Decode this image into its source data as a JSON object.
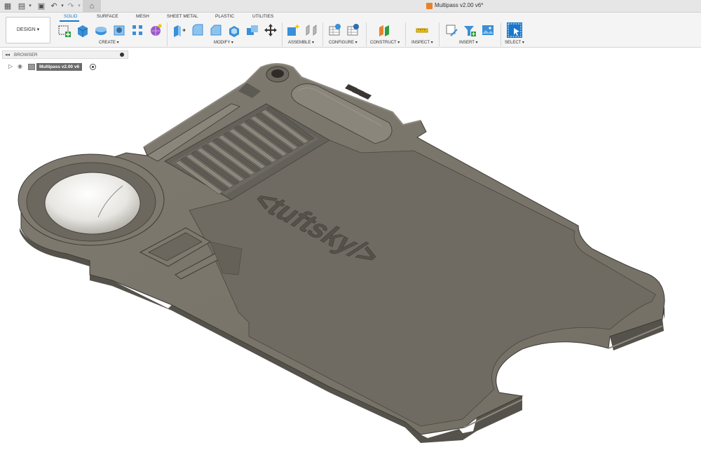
{
  "titlebar": {
    "document_title": "Multipass v2.00 v6*"
  },
  "ribbon": {
    "workspace_label": "DESIGN ▾",
    "tabs": [
      {
        "label": "SOLID",
        "active": true
      },
      {
        "label": "SURFACE"
      },
      {
        "label": "MESH"
      },
      {
        "label": "SHEET METAL"
      },
      {
        "label": "PLASTIC"
      },
      {
        "label": "UTILITIES"
      }
    ],
    "groups": {
      "create": "CREATE ▾",
      "modify": "MODIFY ▾",
      "assemble": "ASSEMBLE ▾",
      "configure": "CONFIGURE ▾",
      "construct": "CONSTRUCT ▾",
      "inspect": "INSPECT ▾",
      "insert": "INSERT ▾",
      "select": "SELECT ▾"
    }
  },
  "browser": {
    "title": "BROWSER",
    "component_name": "Multipass v2.00 v6"
  },
  "model": {
    "engraving": "<tuftsky/>"
  },
  "colors": {
    "accent": "#1a76c9",
    "model_surface": "#7a766c",
    "model_dark": "#5a564e",
    "model_light": "#8c887e",
    "model_edge": "#3e3b36"
  }
}
